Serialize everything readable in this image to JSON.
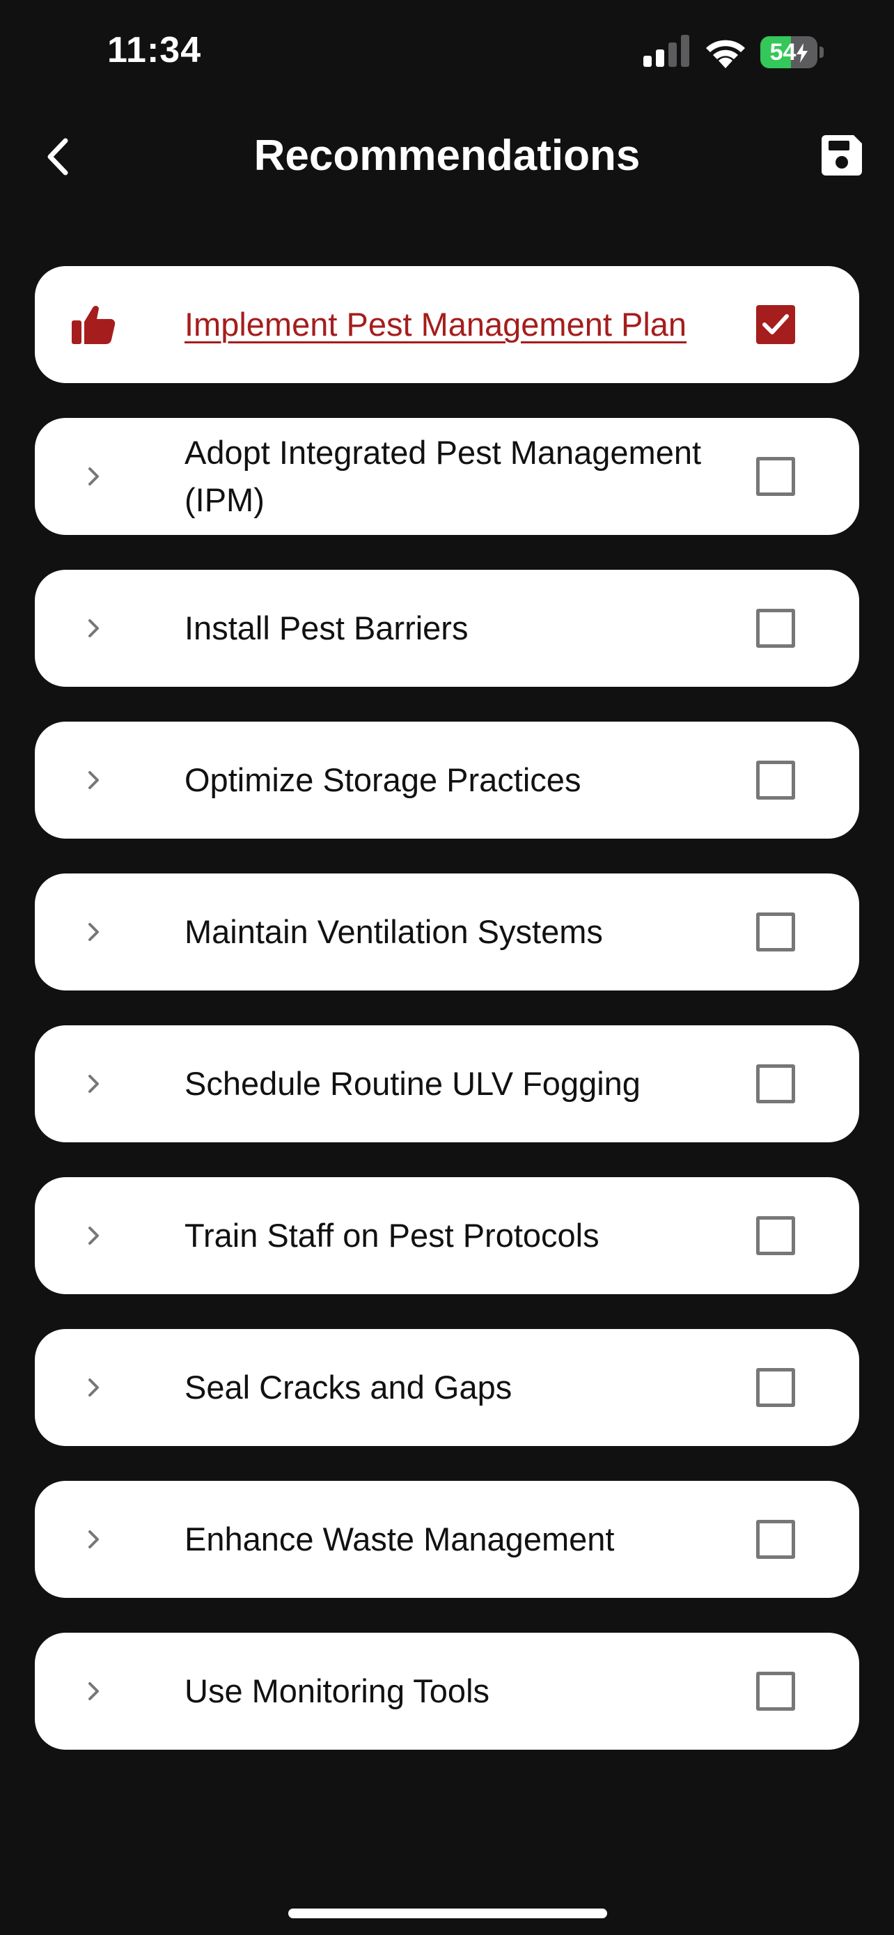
{
  "status_bar": {
    "time": "11:34",
    "battery_level": "54",
    "battery_fill_percent": 54,
    "icons": [
      "cellular-signal-icon",
      "wifi-icon",
      "charging-battery-icon"
    ]
  },
  "header": {
    "title": "Recommendations",
    "back_icon": "chevron-left-icon",
    "save_icon": "floppy-disk-save-icon"
  },
  "colors": {
    "background": "#111111",
    "card": "#ffffff",
    "accent": "#a51d1d",
    "checkbox_border": "#777777",
    "battery_green": "#34c759"
  },
  "recommendations": [
    {
      "label": "Implement Pest Management Plan",
      "selected": true,
      "leading_icon": "thumbs-up-icon"
    },
    {
      "label": "Adopt Integrated Pest Management (IPM)",
      "selected": false,
      "leading_icon": "chevron-right-icon"
    },
    {
      "label": "Install Pest Barriers",
      "selected": false,
      "leading_icon": "chevron-right-icon"
    },
    {
      "label": "Optimize Storage Practices",
      "selected": false,
      "leading_icon": "chevron-right-icon"
    },
    {
      "label": "Maintain Ventilation Systems",
      "selected": false,
      "leading_icon": "chevron-right-icon"
    },
    {
      "label": "Schedule Routine ULV Fogging",
      "selected": false,
      "leading_icon": "chevron-right-icon"
    },
    {
      "label": "Train Staff on Pest Protocols",
      "selected": false,
      "leading_icon": "chevron-right-icon"
    },
    {
      "label": "Seal Cracks and Gaps",
      "selected": false,
      "leading_icon": "chevron-right-icon"
    },
    {
      "label": "Enhance Waste Management",
      "selected": false,
      "leading_icon": "chevron-right-icon"
    },
    {
      "label": "Use Monitoring Tools",
      "selected": false,
      "leading_icon": "chevron-right-icon"
    }
  ]
}
